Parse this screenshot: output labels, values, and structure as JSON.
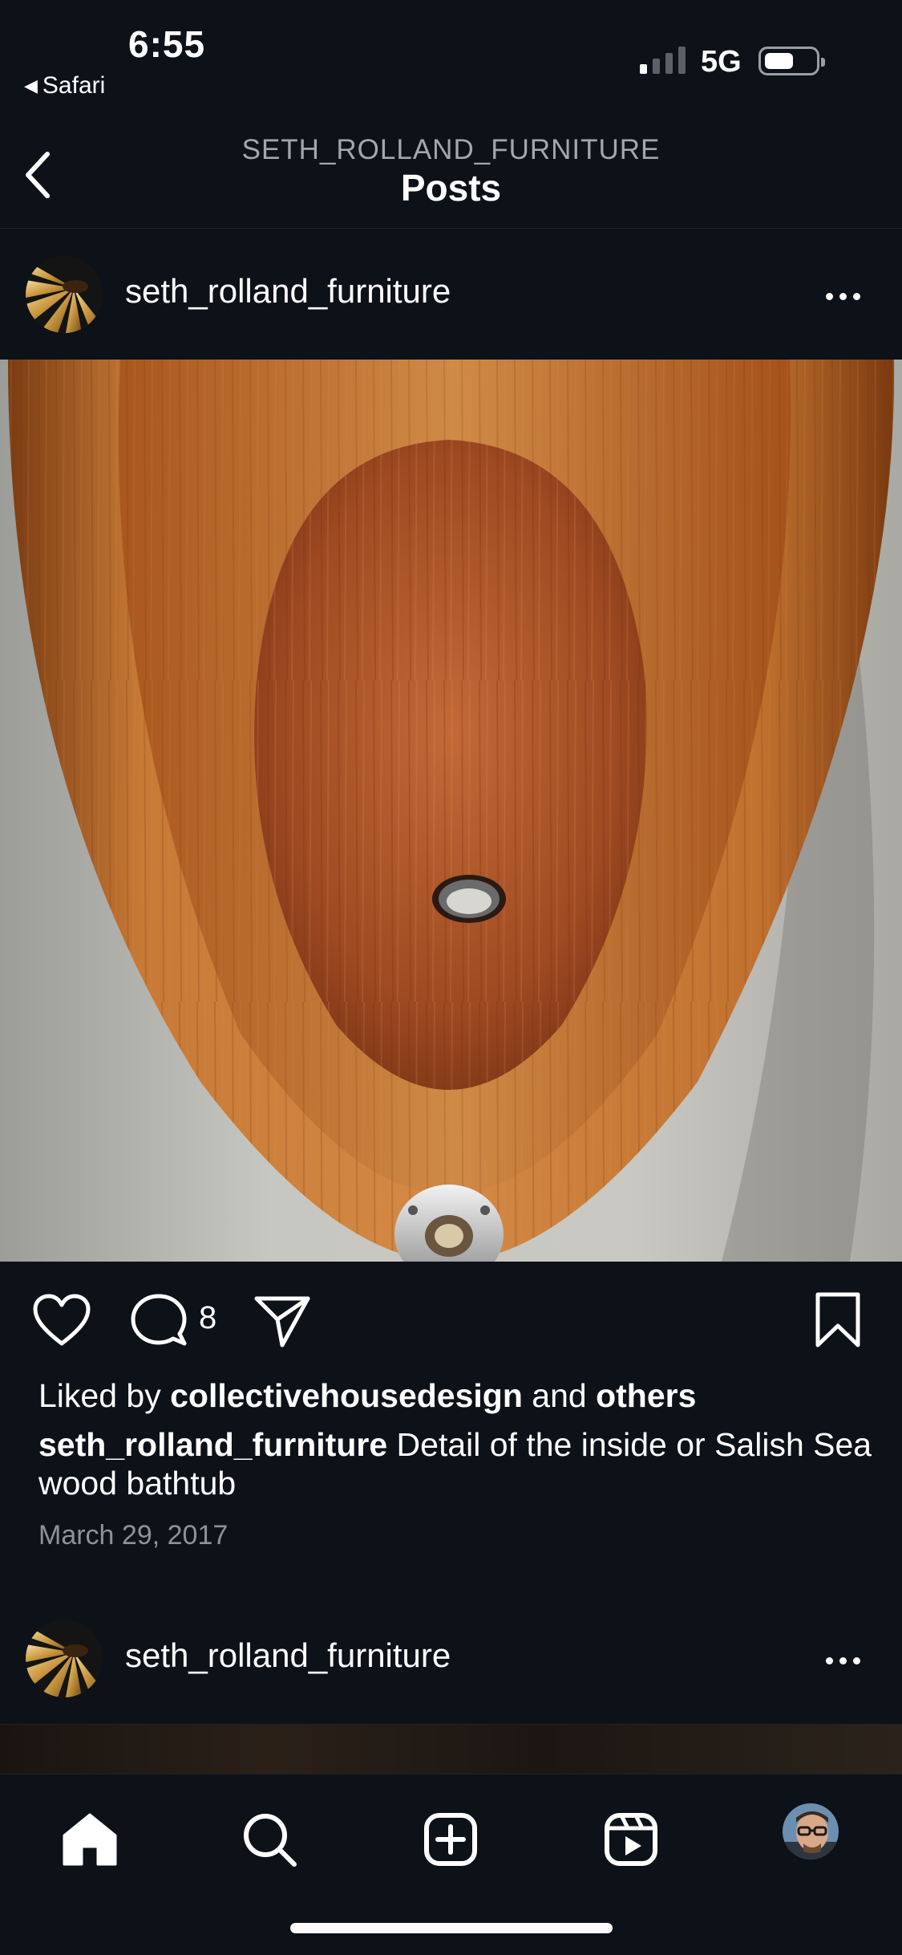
{
  "status_bar": {
    "time": "6:55",
    "back_app": "Safari",
    "network": "5G",
    "battery_level": 0.55
  },
  "header": {
    "subtitle": "SETH_ROLLAND_FURNITURE",
    "title": "Posts"
  },
  "post": {
    "username": "seth_rolland_furniture",
    "comment_count": "8",
    "likes_prefix": "Liked by",
    "liked_by": "collectivehousedesign",
    "likes_join": "and",
    "likes_others": "others",
    "caption_user": "seth_rolland_furniture",
    "caption_text": "Detail of the inside or Salish Sea wood bathtub",
    "date": "March 29, 2017"
  },
  "next_post": {
    "username": "seth_rolland_furniture"
  },
  "icons": {
    "back": "chevron-left-icon",
    "like": "heart-icon",
    "comment": "comment-icon",
    "share": "paper-plane-icon",
    "save": "bookmark-icon",
    "home": "home-icon",
    "search": "search-icon",
    "create": "plus-square-icon",
    "reels": "reels-icon"
  },
  "colors": {
    "background": "#0d1118",
    "text": "#ffffff",
    "muted": "#8d9198"
  }
}
